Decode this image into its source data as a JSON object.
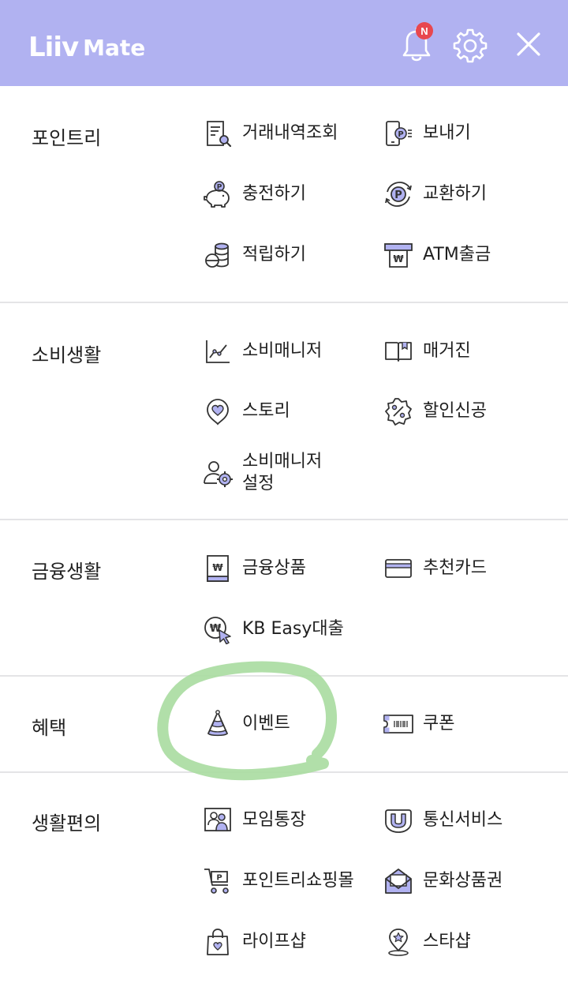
{
  "header": {
    "logo_main": "Liiv",
    "logo_sub": "Mate",
    "notification_badge": "N"
  },
  "sections": [
    {
      "title": "포인트리",
      "items": [
        {
          "label": "거래내역조회",
          "icon": "receipt-search-icon"
        },
        {
          "label": "보내기",
          "icon": "phone-send-point-icon"
        },
        {
          "label": "충전하기",
          "icon": "piggy-bank-point-icon"
        },
        {
          "label": "교환하기",
          "icon": "exchange-point-icon"
        },
        {
          "label": "적립하기",
          "icon": "coin-stack-icon"
        },
        {
          "label": "ATM출금",
          "icon": "atm-withdraw-icon"
        }
      ]
    },
    {
      "title": "소비생활",
      "items": [
        {
          "label": "소비매니저",
          "icon": "line-chart-icon"
        },
        {
          "label": "매거진",
          "icon": "open-book-icon"
        },
        {
          "label": "스토리",
          "icon": "heart-bubble-icon"
        },
        {
          "label": "할인신공",
          "icon": "discount-badge-icon"
        },
        {
          "label": "소비매니저\n설정",
          "label_line1": "소비매니저",
          "label_line2": "설정",
          "icon": "user-gear-icon"
        }
      ]
    },
    {
      "title": "금융생활",
      "items": [
        {
          "label": "금융상품",
          "icon": "finance-book-icon"
        },
        {
          "label": "추천카드",
          "icon": "credit-card-icon"
        },
        {
          "label": "KB Easy대출",
          "icon": "loan-click-icon"
        }
      ]
    },
    {
      "title": "혜택",
      "items": [
        {
          "label": "이벤트",
          "icon": "party-hat-icon"
        },
        {
          "label": "쿠폰",
          "icon": "coupon-ticket-icon"
        }
      ]
    },
    {
      "title": "생활편의",
      "items": [
        {
          "label": "모임통장",
          "icon": "group-account-icon"
        },
        {
          "label": "통신서비스",
          "icon": "telecom-u-icon"
        },
        {
          "label": "포인트리쇼핑몰",
          "icon": "shopping-cart-point-icon"
        },
        {
          "label": "문화상품권",
          "icon": "envelope-voucher-icon"
        },
        {
          "label": "라이프샵",
          "icon": "shopping-bag-heart-icon"
        },
        {
          "label": "스타샵",
          "icon": "star-pin-icon"
        }
      ]
    }
  ],
  "colors": {
    "header_bg": "#b1b2f1",
    "accent": "#8a84e6",
    "badge": "#e8474f",
    "highlight_circle": "#a8dba0"
  }
}
